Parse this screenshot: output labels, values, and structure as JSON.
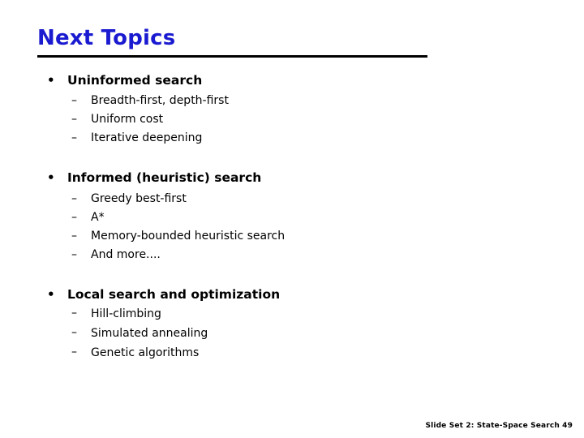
{
  "slide": {
    "title": "Next Topics",
    "title_color": "#1a1ad0",
    "rule_color": "#000000",
    "background_color": "#ffffff",
    "bullet_glyph": "•",
    "dash_glyph": "–",
    "groups": [
      {
        "heading": "Uninformed search",
        "items": [
          "Breadth-first, depth-first",
          "Uniform cost",
          "Iterative deepening"
        ]
      },
      {
        "heading": "Informed (heuristic) search",
        "items": [
          "Greedy best-first",
          "A*",
          "Memory-bounded heuristic search",
          "And more...."
        ]
      },
      {
        "heading": "Local search and optimization",
        "items": [
          "Hill-climbing",
          "Simulated annealing",
          "Genetic algorithms"
        ]
      }
    ],
    "footer": "Slide Set 2: State-Space Search  49"
  }
}
